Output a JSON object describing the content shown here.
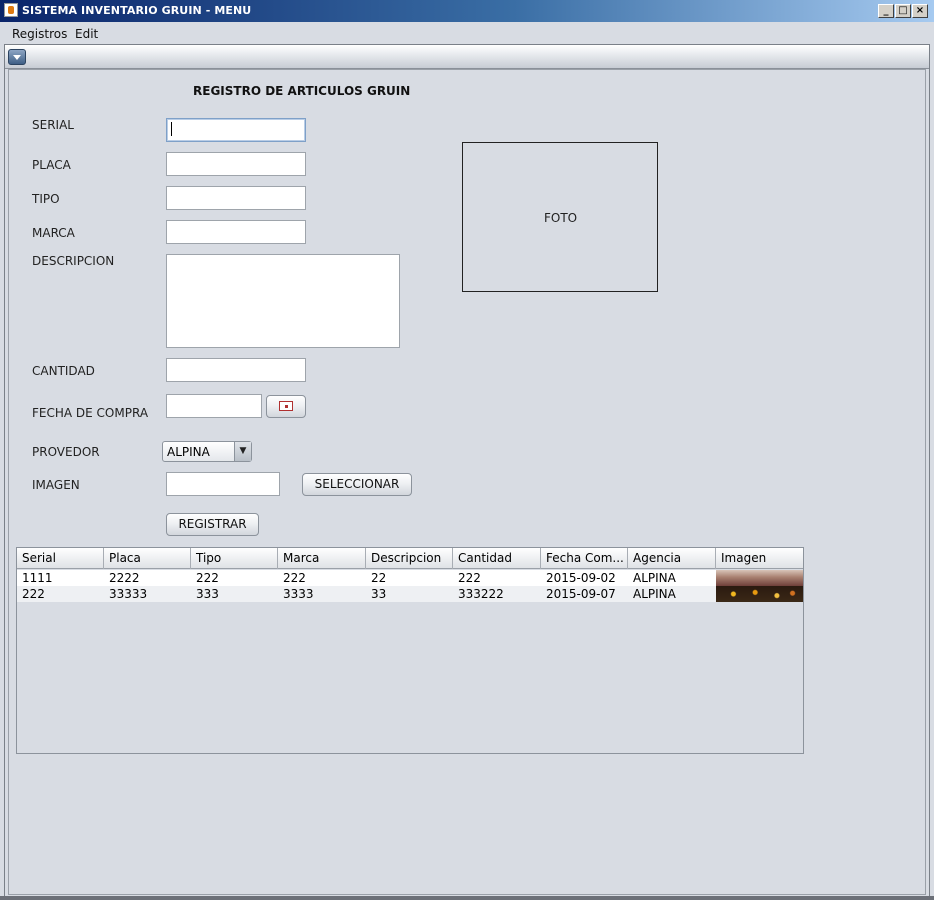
{
  "window": {
    "title": "SISTEMA INVENTARIO GRUIN - MENU",
    "controls": {
      "minimize": "_",
      "maximize": "□",
      "close": "×"
    }
  },
  "menubar": {
    "items": [
      "Registros",
      "Edit"
    ]
  },
  "form": {
    "title": "REGISTRO DE ARTICULOS GRUIN",
    "labels": {
      "serial": "SERIAL",
      "placa": "PLACA",
      "tipo": "TIPO",
      "marca": "MARCA",
      "descripcion": "DESCRIPCION",
      "cantidad": "CANTIDAD",
      "fecha": "FECHA DE COMPRA",
      "proveedor": "PROVEDOR",
      "imagen": "IMAGEN"
    },
    "values": {
      "serial": "",
      "placa": "",
      "tipo": "",
      "marca": "",
      "descripcion": "",
      "cantidad": "",
      "fecha": "",
      "imagen": ""
    },
    "proveedor_selected": "ALPINA",
    "buttons": {
      "seleccionar": "SELECCIONAR",
      "registrar": "REGISTRAR"
    },
    "foto_label": "FOTO"
  },
  "table": {
    "columns": [
      "Serial",
      "Placa",
      "Tipo",
      "Marca",
      "Descripcion",
      "Cantidad",
      "Fecha Com...",
      "Agencia",
      "Imagen"
    ],
    "rows": [
      [
        "1111",
        "2222",
        "222",
        "222",
        "22",
        "222",
        "2015-09-02",
        "ALPINA"
      ],
      [
        "222",
        "33333",
        "333",
        "3333",
        "33",
        "333222",
        "2015-09-07",
        "ALPINA"
      ]
    ]
  },
  "icons": [
    "app-icon",
    "frame-menu-icon",
    "calendar-icon",
    "dropdown-arrow-icon"
  ]
}
